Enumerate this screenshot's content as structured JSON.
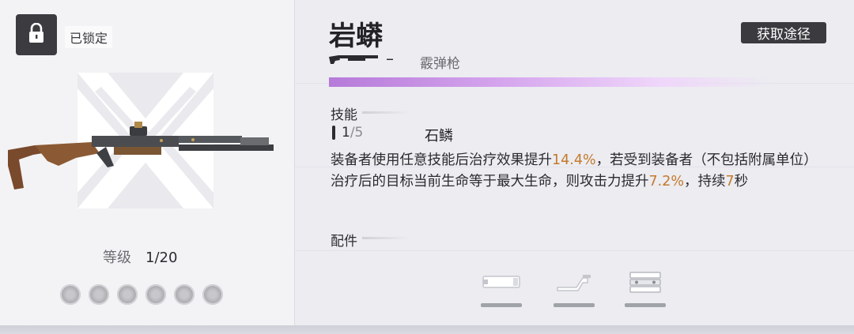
{
  "weapon": {
    "name": "岩蟒",
    "type_separator": "–",
    "type": "霰弹枪",
    "rarity_color": "#b67ad9"
  },
  "lock": {
    "icon": "lock-icon",
    "label": "已锁定"
  },
  "source_button": {
    "label": "获取途径"
  },
  "level": {
    "label": "等级",
    "value": "1/20"
  },
  "stars": {
    "count": 6,
    "filled": 0
  },
  "skill": {
    "section_label": "技能",
    "level_current": "1",
    "level_max": "/5",
    "name": "石鳞",
    "description": {
      "p1": "装备者使用任意技能后治疗效果提升",
      "v1": "14.4%",
      "p2": "，若受到装备者（不包括附属单位）治疗后的目标当前生命等于最大生命，则攻击力提升",
      "v2": "7.2%",
      "p3": "，持续",
      "v3": "7",
      "p4": "秒"
    }
  },
  "parts": {
    "section_label": "配件",
    "slots": [
      {
        "icon": "muzzle-icon"
      },
      {
        "icon": "stock-icon"
      },
      {
        "icon": "magazine-icon"
      }
    ]
  },
  "colors": {
    "highlight": "#c47a2c",
    "dark_button": "#3a3a3f"
  }
}
